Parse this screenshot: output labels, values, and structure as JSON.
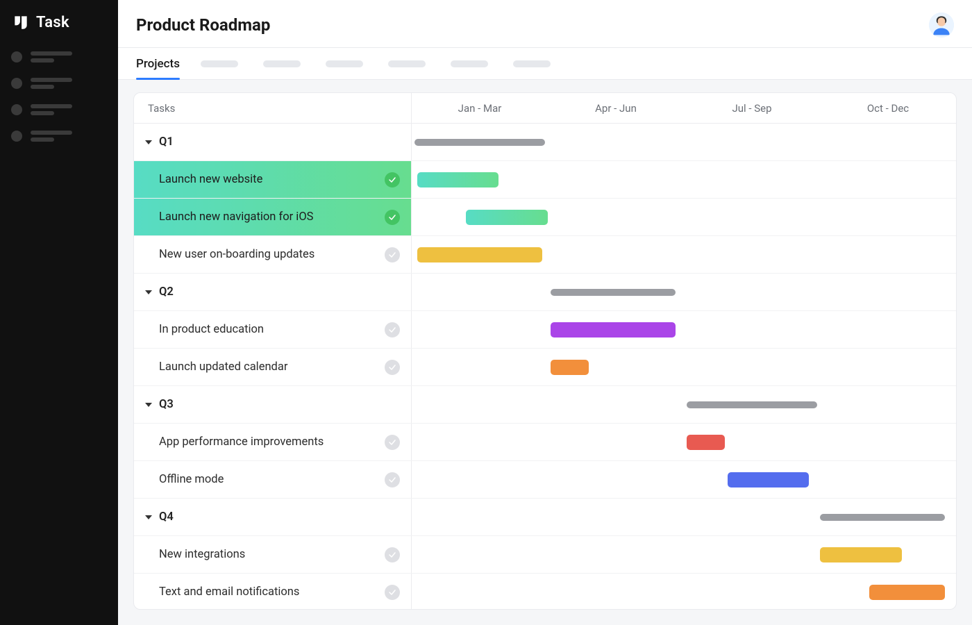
{
  "brand": {
    "name": "Task"
  },
  "header": {
    "title": "Product Roadmap"
  },
  "tabs": {
    "active": "Projects",
    "placeholder_count": 6
  },
  "sidebar": {
    "placeholder_items": 4
  },
  "timeline": {
    "tasks_column_label": "Tasks",
    "columns": [
      "Jan - Mar",
      "Apr - Jun",
      "Jul - Sep",
      "Oct - Dec"
    ]
  },
  "quarters": [
    {
      "label": "Q1",
      "group_bar": {
        "start_pct": 0.5,
        "width_pct": 24
      },
      "tasks": [
        {
          "label": "Launch new website",
          "status": "done",
          "highlight": "green",
          "bar": {
            "start_pct": 1,
            "width_pct": 15,
            "color": "green-grad"
          }
        },
        {
          "label": "Launch new navigation for iOS",
          "status": "done",
          "highlight": "green",
          "bar": {
            "start_pct": 10,
            "width_pct": 15,
            "color": "green-grad"
          }
        },
        {
          "label": "New user on-boarding updates",
          "status": "pending",
          "bar": {
            "start_pct": 1,
            "width_pct": 23,
            "color": "yellow"
          }
        }
      ]
    },
    {
      "label": "Q2",
      "group_bar": {
        "start_pct": 25.5,
        "width_pct": 23
      },
      "tasks": [
        {
          "label": "In product education",
          "status": "pending",
          "bar": {
            "start_pct": 25.5,
            "width_pct": 23,
            "color": "purple"
          }
        },
        {
          "label": "Launch updated calendar",
          "status": "pending",
          "bar": {
            "start_pct": 25.5,
            "width_pct": 7,
            "color": "orange"
          }
        }
      ]
    },
    {
      "label": "Q3",
      "group_bar": {
        "start_pct": 50.5,
        "width_pct": 24
      },
      "tasks": [
        {
          "label": "App performance improvements",
          "status": "pending",
          "bar": {
            "start_pct": 50.5,
            "width_pct": 7,
            "color": "red"
          }
        },
        {
          "label": "Offline mode",
          "status": "pending",
          "bar": {
            "start_pct": 58,
            "width_pct": 15,
            "color": "blue"
          }
        }
      ]
    },
    {
      "label": "Q4",
      "group_bar": {
        "start_pct": 75,
        "width_pct": 23
      },
      "tasks": [
        {
          "label": "New integrations",
          "status": "pending",
          "bar": {
            "start_pct": 75,
            "width_pct": 15,
            "color": "yellow"
          }
        },
        {
          "label": "Text  and email notifications",
          "status": "pending",
          "bar": {
            "start_pct": 84,
            "width_pct": 14,
            "color": "orange"
          }
        }
      ]
    }
  ],
  "colors": {
    "green-grad": "linear-gradient(90deg,#57dcc4,#67dd8f)",
    "yellow": "#eec040",
    "purple": "#aa45e8",
    "orange": "#f28f3b",
    "red": "#e85a51",
    "blue": "#546dee",
    "group": "#9b9da2"
  }
}
